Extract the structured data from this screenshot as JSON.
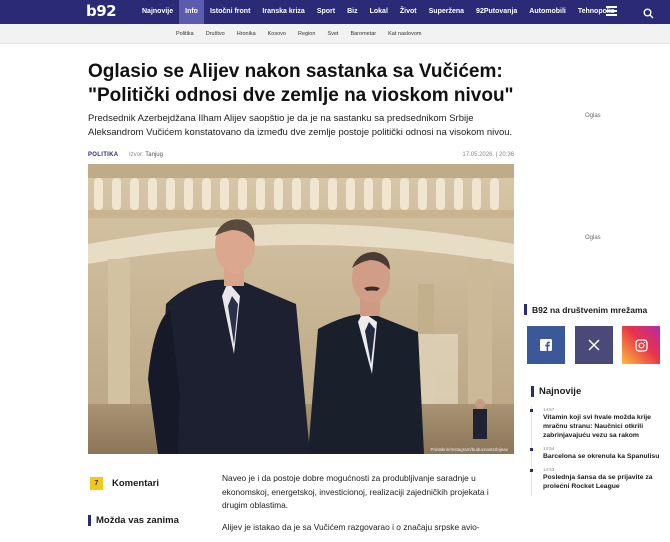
{
  "header": {
    "logo": "b92",
    "nav": [
      "Najnovije",
      "Info",
      "Istočni front",
      "Iranska kriza",
      "Sport",
      "Biz",
      "Lokal",
      "Život",
      "Superžena",
      "92Putovanja",
      "Automobili",
      "Tehnopolis"
    ],
    "active_nav": "Info"
  },
  "subnav": [
    "Politika",
    "Društvo",
    "Hronika",
    "Kosovo",
    "Region",
    "Svet",
    "Barometar",
    "Kat naslovom"
  ],
  "article": {
    "headline": "Oglasio se Alijev nakon sastanka sa Vučićem: \"Politički odnosi dve zemlje na vioskom nivou\"",
    "lead": "Predsednik Azerbejdžana Ilham Alijev saopštio je da je na sastanku sa predsednikom Srbije Aleksandrom Vučićem konstatovano da između dve zemlje postoje politički odnosi na visokom nivou.",
    "category": "POLITIKA",
    "source_label": "Izvor:",
    "source": "Tanjug",
    "date": "17.05.2026. | 20:36",
    "image_credit": "Printskrin/Instagram/buducnostsrbijeav",
    "comments_count": "7",
    "comments_label": "Komentari",
    "related_label": "Možda vas zanima",
    "paragraphs": [
      "Naveo je i da postoje dobre mogućnosti za produbljivanje saradnje u ekonomskoj, energetskoj, investicionoj, realizaciji zajedničkih projekata i drugim oblastima.",
      "Alijev je istakao da je sa Vučićem razgovarao i o značaju srpske avio-"
    ]
  },
  "sidebar": {
    "ad_label_1": "Oglas",
    "ad_label_2": "Oglas",
    "social_title": "B92 na društvenim mrežama",
    "social": [
      "facebook",
      "x",
      "instagram"
    ],
    "latest_title": "Najnovije",
    "latest": [
      {
        "time": "14:57",
        "text": "Vitamin koji svi hvale možda krije mračnu stranu: Naučnici otkrili zabrinjavajuću vezu sa rakom"
      },
      {
        "time": "14:54",
        "text": "Barcelona se okrenula ka Spanulisu"
      },
      {
        "time": "14:53",
        "text": "Poslednja šansa da se prijavite za prolećni Rocket League"
      }
    ]
  },
  "colors": {
    "brand": "#2a2a76",
    "active_tab": "#5b5bb0",
    "badge": "#f3c71b"
  }
}
